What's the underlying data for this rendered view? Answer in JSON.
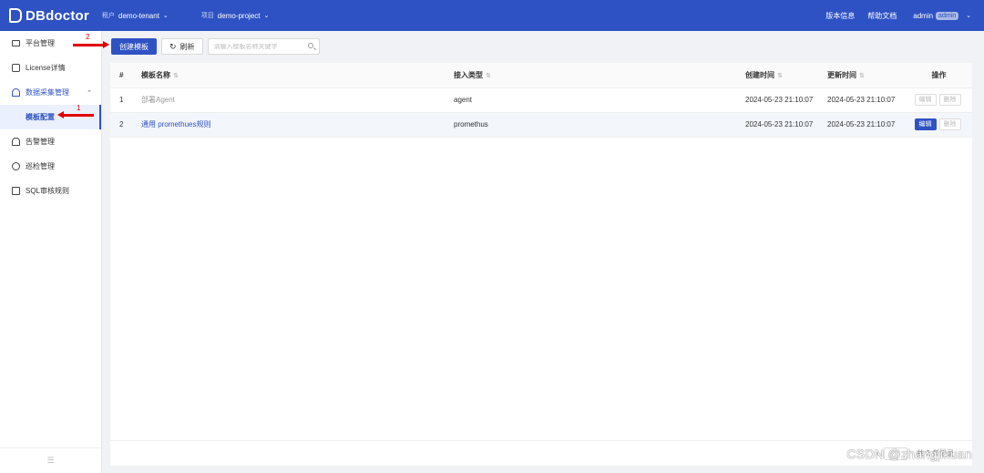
{
  "app": {
    "logo_text": "DBdoctor"
  },
  "header": {
    "tenant_label": "租户",
    "tenant_value": "demo-tenant",
    "project_label": "项目",
    "project_value": "demo-project",
    "version_link": "版本信息",
    "help_link": "帮助文档",
    "user_name": "admin",
    "user_badge": "admin"
  },
  "sidebar": {
    "items": [
      {
        "label": "平台管理",
        "icon": "monitor-icon"
      },
      {
        "label": "License详情",
        "icon": "lock-icon"
      },
      {
        "label": "数据采集管理",
        "icon": "people-icon"
      },
      {
        "label": "模板配置",
        "icon": ""
      },
      {
        "label": "告警管理",
        "icon": "bell-icon"
      },
      {
        "label": "巡检管理",
        "icon": "cycle-icon"
      },
      {
        "label": "SQL审核规则",
        "icon": "document-icon"
      }
    ],
    "collapse_icon": "☰"
  },
  "toolbar": {
    "create_label": "创建模板",
    "refresh_label": "刷新",
    "search_placeholder": "请输入模板名称关键字"
  },
  "table": {
    "columns": [
      "#",
      "模板名称",
      "接入类型",
      "创建时间",
      "更新时间",
      "操作"
    ],
    "rows": [
      {
        "index": "1",
        "name": "部署Agent",
        "type": "agent",
        "created": "2024-05-23 21:10:07",
        "updated": "2024-05-23 21:10:07",
        "edit": "编辑",
        "delete": "删除"
      },
      {
        "index": "2",
        "name": "通用 promethues规则",
        "type": "promethus",
        "created": "2024-05-23 21:10:07",
        "updated": "2024-05-23 21:10:07",
        "edit": "编辑",
        "delete": "删除"
      }
    ]
  },
  "pagination": {
    "prev": "‹",
    "count": "共 2 条记录"
  },
  "annotations": {
    "one": "1",
    "two": "2"
  },
  "watermark": "CSDN @zhangjikuan",
  "colors": {
    "brand": "#2e52c4",
    "annotation": "#e00000"
  }
}
